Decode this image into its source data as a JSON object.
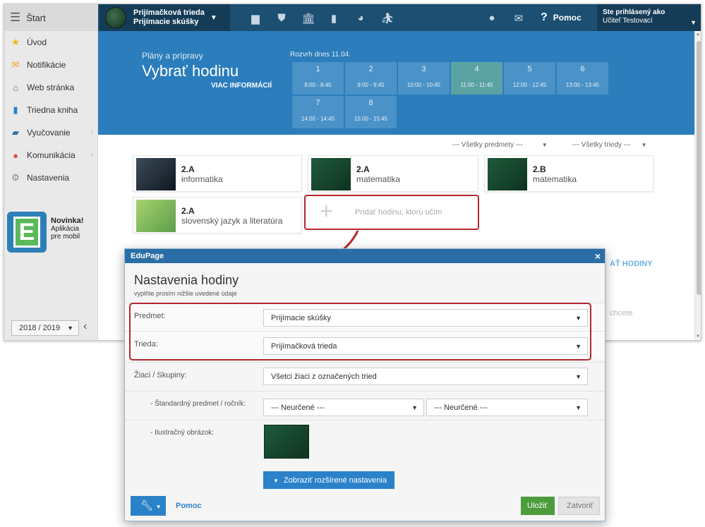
{
  "topbar": {
    "start_label": "Štart",
    "class_line1": "Prijímačková trieda",
    "class_line2": "Prijímacie skúšky",
    "help_label": "Pomoc",
    "user_line1": "Ste prihlásený ako",
    "user_line2": "Učiteľ Testovací"
  },
  "sidebar": {
    "items": [
      {
        "label": "Úvod",
        "icon": "star-icon"
      },
      {
        "label": "Notifikácie",
        "icon": "envelope-icon"
      },
      {
        "label": "Web stránka",
        "icon": "home-icon"
      },
      {
        "label": "Triedna kniha",
        "icon": "book-icon"
      },
      {
        "label": "Vyučovanie",
        "icon": "open-book-icon"
      },
      {
        "label": "Komunikácia",
        "icon": "chat-icon"
      },
      {
        "label": "Nastavenia",
        "icon": "gear-icon"
      }
    ],
    "promo_title": "Novinka!",
    "promo_line1": "Aplikácia",
    "promo_line2": "pre mobil",
    "year": "2018 / 2019"
  },
  "hero": {
    "subtitle": "Plány a prípravy",
    "title": "Vybrať hodinu",
    "more": "VIAC INFORMÁCIÍ",
    "schedule_title": "Rozvrh dnes 11.04.",
    "slots": [
      {
        "n": "1",
        "t": "8:00 - 8:45"
      },
      {
        "n": "2",
        "t": "9:00 - 9:45"
      },
      {
        "n": "3",
        "t": "10:00 - 10:45"
      },
      {
        "n": "4",
        "t": "11:00 - 11:45"
      },
      {
        "n": "5",
        "t": "12:00 - 12:45"
      },
      {
        "n": "6",
        "t": "13:00 - 13:45"
      },
      {
        "n": "7",
        "t": "14:00 - 14:45"
      },
      {
        "n": "8",
        "t": "15:00 - 15:45"
      }
    ]
  },
  "filters": {
    "subjects": "--- Všetky predmety ---",
    "classes": "--- Všetky triedy ---"
  },
  "cards": [
    {
      "cls": "2.A",
      "subj": "informatika"
    },
    {
      "cls": "2.A",
      "subj": "matematika"
    },
    {
      "cls": "2.B",
      "subj": "matematika"
    },
    {
      "cls": "2.A",
      "subj": "slovenský jazyk a literatúra"
    }
  ],
  "add_card_label": "Pridať hodinu, ktorú učím",
  "behind": {
    "link": "AŤ HODINY",
    "text": "chcete"
  },
  "modal": {
    "header": "EduPage",
    "title": "Nastavenia hodiny",
    "subtitle": "vyplňte prosím nižšie uvedené údaje",
    "subject_label": "Predmet:",
    "subject_value": "Prijímacie skúšky",
    "class_label": "Trieda:",
    "class_value": "Prijímačková trieda",
    "groups_label": "Žiaci / Skupiny:",
    "groups_value": "Všetci žiaci z označených tried",
    "standard_label": "- Štandardný predmet / ročník:",
    "standard_value1": "--- Neurčené ---",
    "standard_value2": "--- Neurčené ---",
    "image_label": "- Ilustračný obrázok:",
    "advanced_button": "Zobraziť rozšírené nastavenia",
    "help_link": "Pomoc",
    "save_button": "Uložiť",
    "close_button": "Zatvoriť"
  },
  "colors": {
    "topbar": "#1c4f72",
    "hero": "#2b7dbb",
    "highlight": "#b5262d",
    "save": "#4c9c3c"
  }
}
